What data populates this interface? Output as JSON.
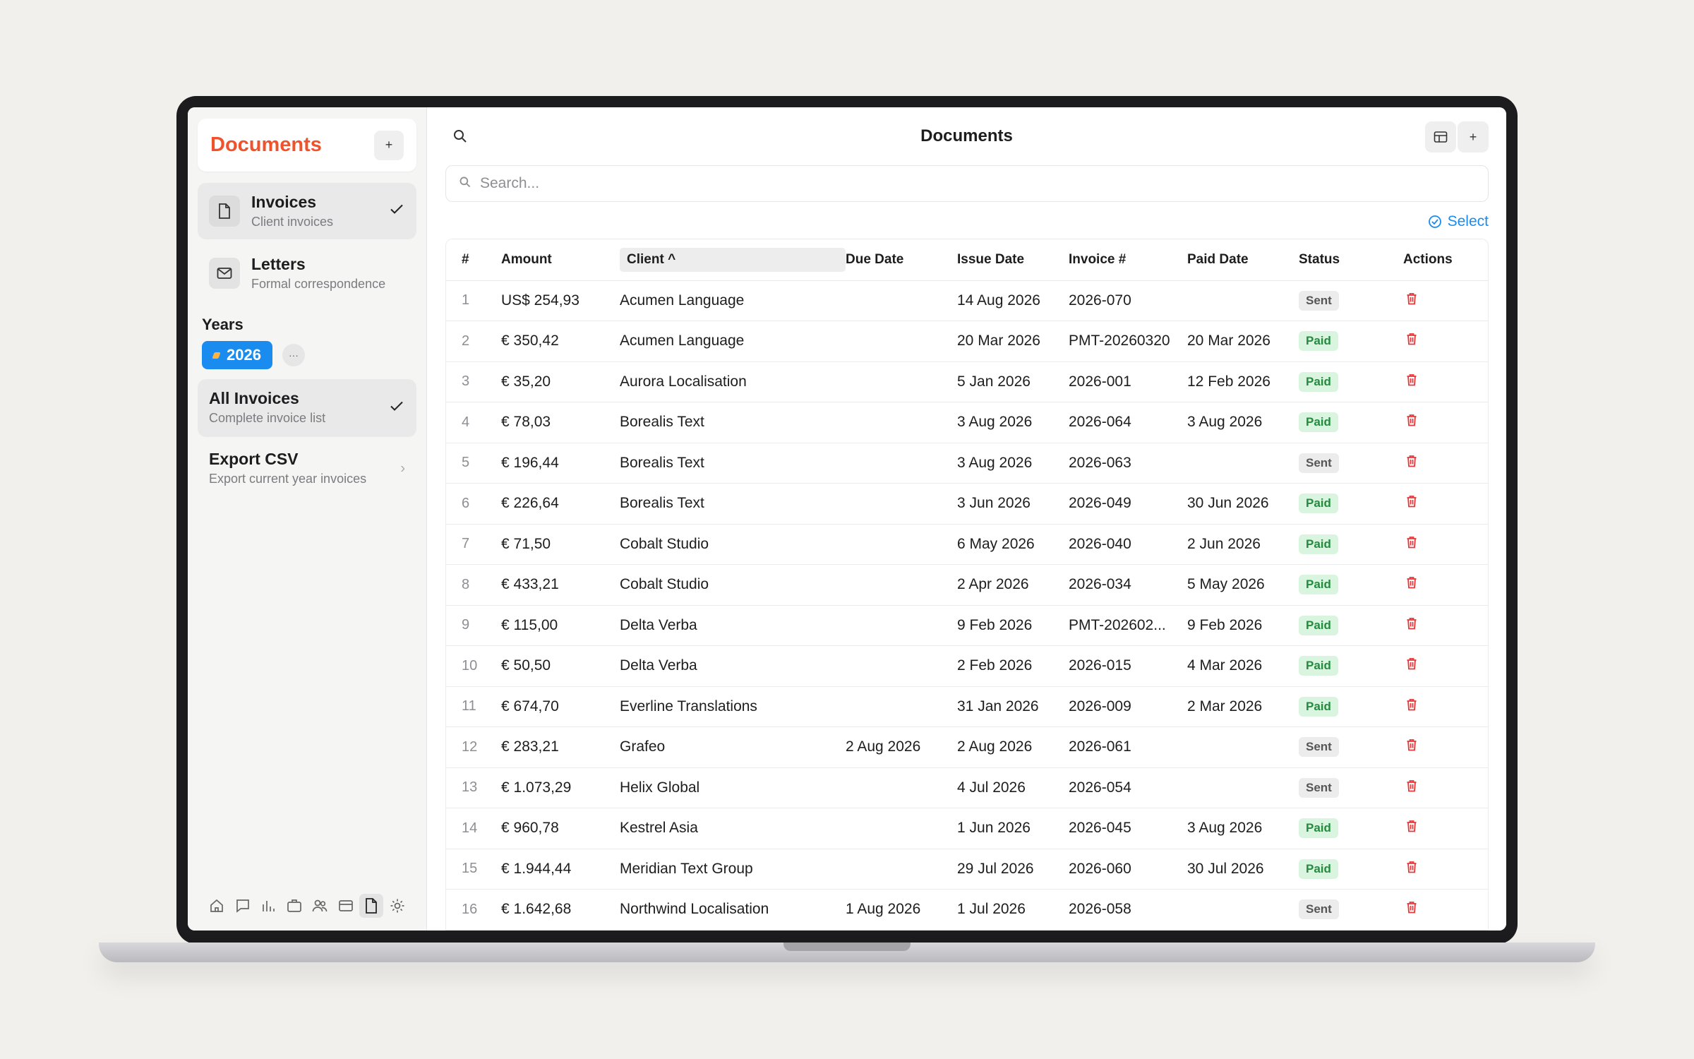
{
  "sidebar": {
    "title": "Documents",
    "add_label": "+",
    "nav": [
      {
        "title": "Invoices",
        "subtitle": "Client invoices",
        "icon": "document-icon",
        "active": true
      },
      {
        "title": "Letters",
        "subtitle": "Formal correspondence",
        "icon": "mail-icon",
        "active": false
      }
    ],
    "years_label": "Years",
    "years": [
      "2026"
    ],
    "more_label": "···",
    "lists": [
      {
        "title": "All Invoices",
        "subtitle": "Complete invoice list",
        "active": true
      },
      {
        "title": "Export CSV",
        "subtitle": "Export current year invoices",
        "active": false
      }
    ],
    "bottom_icons": [
      "home-icon",
      "chat-icon",
      "chart-icon",
      "briefcase-icon",
      "users-icon",
      "card-icon",
      "document-icon",
      "settings-icon"
    ]
  },
  "main": {
    "title": "Documents",
    "add_label": "+",
    "search_placeholder": "Search...",
    "select_label": "Select",
    "columns": {
      "num": "#",
      "amount": "Amount",
      "client": "Client",
      "client_sort": "^",
      "due": "Due Date",
      "issue": "Issue Date",
      "invoice": "Invoice #",
      "paid": "Paid Date",
      "status": "Status",
      "actions": "Actions"
    },
    "rows": [
      {
        "n": "1",
        "amount": "US$ 254,93",
        "client": "Acumen Language",
        "due": "",
        "issue": "14 Aug 2026",
        "invoice": "2026-070",
        "paid": "",
        "status": "Sent"
      },
      {
        "n": "2",
        "amount": "€ 350,42",
        "client": "Acumen Language",
        "due": "",
        "issue": "20 Mar 2026",
        "invoice": "PMT-20260320",
        "paid": "20 Mar 2026",
        "status": "Paid"
      },
      {
        "n": "3",
        "amount": "€ 35,20",
        "client": "Aurora Localisation",
        "due": "",
        "issue": "5 Jan 2026",
        "invoice": "2026-001",
        "paid": "12 Feb 2026",
        "status": "Paid"
      },
      {
        "n": "4",
        "amount": "€ 78,03",
        "client": "Borealis Text",
        "due": "",
        "issue": "3 Aug 2026",
        "invoice": "2026-064",
        "paid": "3 Aug 2026",
        "status": "Paid"
      },
      {
        "n": "5",
        "amount": "€ 196,44",
        "client": "Borealis Text",
        "due": "",
        "issue": "3 Aug 2026",
        "invoice": "2026-063",
        "paid": "",
        "status": "Sent"
      },
      {
        "n": "6",
        "amount": "€ 226,64",
        "client": "Borealis Text",
        "due": "",
        "issue": "3 Jun 2026",
        "invoice": "2026-049",
        "paid": "30 Jun 2026",
        "status": "Paid"
      },
      {
        "n": "7",
        "amount": "€ 71,50",
        "client": "Cobalt Studio",
        "due": "",
        "issue": "6 May 2026",
        "invoice": "2026-040",
        "paid": "2 Jun 2026",
        "status": "Paid"
      },
      {
        "n": "8",
        "amount": "€ 433,21",
        "client": "Cobalt Studio",
        "due": "",
        "issue": "2 Apr 2026",
        "invoice": "2026-034",
        "paid": "5 May 2026",
        "status": "Paid"
      },
      {
        "n": "9",
        "amount": "€ 115,00",
        "client": "Delta Verba",
        "due": "",
        "issue": "9 Feb 2026",
        "invoice": "PMT-202602...",
        "paid": "9 Feb 2026",
        "status": "Paid"
      },
      {
        "n": "10",
        "amount": "€ 50,50",
        "client": "Delta Verba",
        "due": "",
        "issue": "2 Feb 2026",
        "invoice": "2026-015",
        "paid": "4 Mar 2026",
        "status": "Paid"
      },
      {
        "n": "11",
        "amount": "€ 674,70",
        "client": "Everline Translations",
        "due": "",
        "issue": "31 Jan 2026",
        "invoice": "2026-009",
        "paid": "2 Mar 2026",
        "status": "Paid"
      },
      {
        "n": "12",
        "amount": "€ 283,21",
        "client": "Grafeo",
        "due": "2 Aug 2026",
        "issue": "2 Aug 2026",
        "invoice": "2026-061",
        "paid": "",
        "status": "Sent"
      },
      {
        "n": "13",
        "amount": "€ 1.073,29",
        "client": "Helix Global",
        "due": "",
        "issue": "4 Jul 2026",
        "invoice": "2026-054",
        "paid": "",
        "status": "Sent"
      },
      {
        "n": "14",
        "amount": "€ 960,78",
        "client": "Kestrel Asia",
        "due": "",
        "issue": "1 Jun 2026",
        "invoice": "2026-045",
        "paid": "3 Aug 2026",
        "status": "Paid"
      },
      {
        "n": "15",
        "amount": "€ 1.944,44",
        "client": "Meridian Text Group",
        "due": "",
        "issue": "29 Jul 2026",
        "invoice": "2026-060",
        "paid": "30 Jul 2026",
        "status": "Paid"
      },
      {
        "n": "16",
        "amount": "€ 1.642,68",
        "client": "Northwind Localisation",
        "due": "1 Aug 2026",
        "issue": "1 Jul 2026",
        "invoice": "2026-058",
        "paid": "",
        "status": "Sent"
      }
    ]
  },
  "colors": {
    "brand": "#f0532c",
    "accent": "#1a8cf0",
    "paid_bg": "#daf5df",
    "paid_text": "#238a3e",
    "sent_bg": "#ececec",
    "delete": "#e5383b"
  }
}
